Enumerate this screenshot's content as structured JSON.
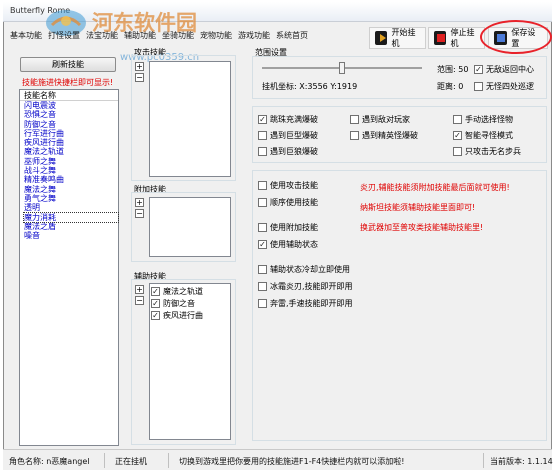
{
  "window": {
    "title": "Butterfly Rome"
  },
  "watermark": {
    "brand": "河东软件园",
    "url": "www.pc0359.cn"
  },
  "menu": [
    "基本功能",
    "打怪设置",
    "法宝功能",
    "辅助功能",
    "坐骑功能",
    "宠物功能",
    "游戏功能",
    "系统首页"
  ],
  "toolbar": {
    "start": "开始挂机",
    "stop": "停止挂机",
    "save": "保存设置"
  },
  "skills": {
    "refresh_label": "刷新技能",
    "hint": "技能施进快捷栏即可显示!",
    "header": "技能名称",
    "items": [
      "闪电震波",
      "恐惧之音",
      "防御之音",
      "行军进行曲",
      "疾风进行曲",
      "魔法之轨道",
      "巫师之舞",
      "战斗之舞",
      "精准奏鸣曲",
      "魔法之舞",
      "勇气之舞",
      "透明",
      "魔力消耗",
      "魔法之盾",
      "噪音"
    ],
    "selected_index": 12
  },
  "attack_skill": {
    "title": "攻击技能"
  },
  "extra_skill": {
    "title": "附加技能"
  },
  "assist_skill": {
    "title": "辅助技能",
    "items": [
      {
        "label": "魔法之轨道",
        "checked": true
      },
      {
        "label": "防御之音",
        "checked": true
      },
      {
        "label": "疾风进行曲",
        "checked": true
      }
    ]
  },
  "range": {
    "title": "范围设置",
    "coord_label": "挂机坐标: X:3556 Y:1919",
    "range_label": "范围: 50",
    "distance_label": "距离: 0",
    "return_center": {
      "label": "无敌返回中心",
      "checked": true
    },
    "patrol": {
      "label": "无怪四处巡逻",
      "checked": false
    },
    "slider_value": 50
  },
  "options_a": [
    {
      "label": "跳珠充满爆破",
      "checked": true
    },
    {
      "label": "遇到巨型爆破",
      "checked": false
    },
    {
      "label": "遇到巨狼爆破",
      "checked": false
    }
  ],
  "options_b": [
    {
      "label": "遇到敌对玩家",
      "checked": false
    },
    {
      "label": "遇到精英怪爆破",
      "checked": false
    }
  ],
  "options_c": [
    {
      "label": "手动选择怪物",
      "checked": false
    },
    {
      "label": "智能寻怪模式",
      "checked": true
    },
    {
      "label": "只攻击无名步兵",
      "checked": false
    }
  ],
  "attack_options": [
    {
      "label": "使用攻击技能",
      "checked": false
    },
    {
      "label": "顺序使用技能",
      "checked": false
    },
    {
      "label": "使用附加技能",
      "checked": false
    },
    {
      "label": "使用辅助状态",
      "checked": true
    },
    {
      "label": "辅助状态冷却立即使用",
      "checked": false
    },
    {
      "label": "冰霜炎刃,技能即开即用",
      "checked": false
    },
    {
      "label": "奔雷,手速技能即开即用",
      "checked": false
    }
  ],
  "notes": [
    "炎刃,辅能技能须附加技能最后面就可使用!",
    "纳斯坦技能须辅助技能里面即可!",
    "换武器加至普攻类技能辅助技能里!"
  ],
  "status": {
    "character": "角色名称: n恶魔angel",
    "state": "正在挂机",
    "hint": "切换到游戏里把你要用的技能施进F1-F4快捷栏内就可以添加啦!",
    "version": "当前版本: 1.1.14"
  },
  "colors": {
    "accent_red": "#e00000",
    "skill_blue": "#0000c8",
    "highlight": "#e8222a"
  }
}
